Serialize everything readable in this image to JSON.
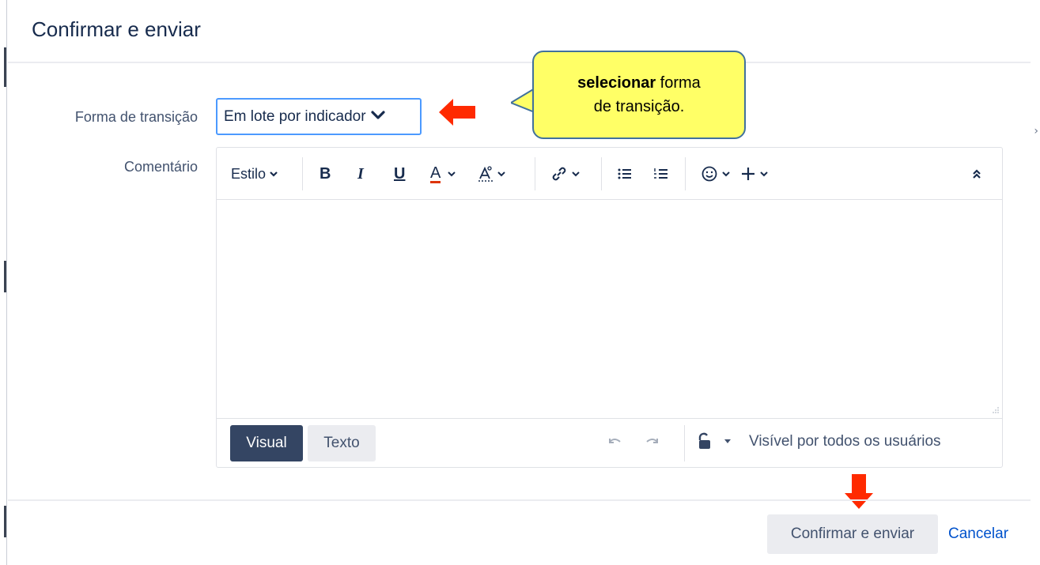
{
  "dialog": {
    "title": "Confirmar e enviar"
  },
  "form": {
    "transition_label": "Forma de transição",
    "transition_value": "Em lote por indicador",
    "comment_label": "Comentário"
  },
  "callout": {
    "bold": "selecionar",
    "text1": " forma",
    "text2": "de transição."
  },
  "toolbar": {
    "style_label": "Estilo",
    "bold": "B",
    "italic": "I",
    "underline": "U",
    "text_color": "A"
  },
  "editor_footer": {
    "visual_label": "Visual",
    "text_label": "Texto",
    "visibility": "Visível por todos os usuários"
  },
  "actions": {
    "confirm_label": "Confirmar e enviar",
    "cancel_label": "Cancelar"
  },
  "colors": {
    "accent_red": "#ff2a00",
    "callout_yellow": "#ffff66",
    "primary_dark": "#344563",
    "link_blue": "#0052cc"
  },
  "icons": [
    "chevron-down-icon",
    "bold-icon",
    "italic-icon",
    "underline-icon",
    "text-color-icon",
    "text-format-icon",
    "link-icon",
    "bullet-list-icon",
    "numbered-list-icon",
    "emoji-icon",
    "plus-icon",
    "collapse-icon",
    "undo-icon",
    "redo-icon",
    "unlock-icon",
    "resize-icon",
    "arrow-left-icon",
    "arrow-down-icon"
  ]
}
